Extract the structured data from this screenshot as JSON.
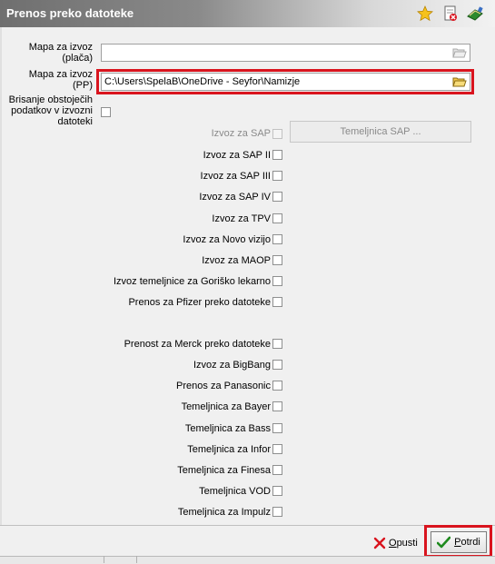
{
  "window": {
    "title": "Prenos preko datoteke",
    "icons": [
      "star-icon",
      "document-delete-icon",
      "book-icon"
    ]
  },
  "fields": {
    "mapa_placa": {
      "label": "Mapa za izvoz\n(plača)",
      "value": ""
    },
    "mapa_pp": {
      "label": "Mapa za izvoz\n(PP)",
      "value": "C:\\Users\\SpelaB\\OneDrive - Seyfor\\Namizje"
    },
    "brisanje": {
      "label": "Brisanje obstoječih\npodatkov v izvozni\ndatoteki",
      "checked": false
    }
  },
  "options_group1": [
    {
      "label": "Izvoz za SAP",
      "checked": false,
      "disabled": true
    },
    {
      "label": "Izvoz za SAP II",
      "checked": false
    },
    {
      "label": "Izvoz za SAP III",
      "checked": false
    },
    {
      "label": "Izvoz za SAP IV",
      "checked": false
    },
    {
      "label": "Izvoz za TPV",
      "checked": false
    },
    {
      "label": "Izvoz za Novo vizijo",
      "checked": false
    },
    {
      "label": "Izvoz za MAOP",
      "checked": false
    },
    {
      "label": "Izvoz temeljnice za Goriško lekarno",
      "checked": false
    },
    {
      "label": "Prenos za Pfizer preko datoteke",
      "checked": false
    }
  ],
  "options_group2": [
    {
      "label": "Prenost za Merck preko datoteke",
      "checked": false
    },
    {
      "label": "Izvoz za BigBang",
      "checked": false
    },
    {
      "label": "Prenos za Panasonic",
      "checked": false
    },
    {
      "label": "Temeljnica za Bayer",
      "checked": false
    },
    {
      "label": "Temeljnica za Bass",
      "checked": false
    },
    {
      "label": "Temeljnica za Infor",
      "checked": false
    },
    {
      "label": "Temeljnica za Finesa",
      "checked": false
    },
    {
      "label": "Temeljnica VOD",
      "checked": false
    },
    {
      "label": "Temeljnica za Impulz",
      "checked": false
    }
  ],
  "buttons": {
    "temeljnica_sap": "Temeljnica SAP ...",
    "cancel_prefix": "O",
    "cancel_rest": "pusti",
    "ok_prefix": "P",
    "ok_rest": "otrdi"
  },
  "colors": {
    "highlight": "#d9141e",
    "ok_check": "#1e8a1e",
    "cancel_x": "#d9141e"
  }
}
